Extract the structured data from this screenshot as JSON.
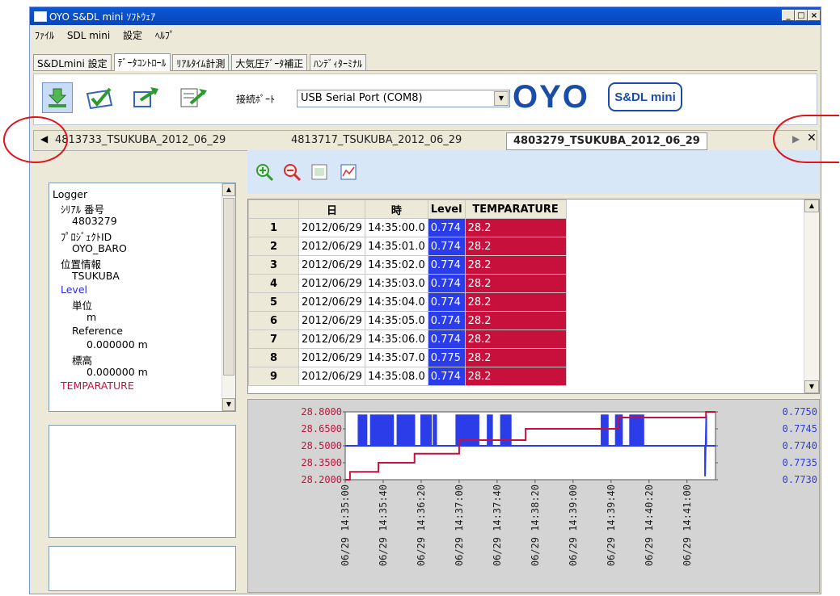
{
  "window": {
    "title": "OYO S&DL mini ｿﾌﾄｳｪｱ"
  },
  "menu": [
    "ﾌｧｲﾙ",
    "SDL mini",
    "設定",
    "ﾍﾙﾌﾟ"
  ],
  "main_tabs": [
    {
      "label": "S&DLmini 設定",
      "active": false
    },
    {
      "label": "ﾃﾞｰﾀｺﾝﾄﾛｰﾙ",
      "active": true
    },
    {
      "label": "ﾘｱﾙﾀｲﾑ計測",
      "active": false
    },
    {
      "label": "大気圧ﾃﾞｰﾀ補正",
      "active": false
    },
    {
      "label": "ﾊﾝﾃﾞｨﾀｰﾐﾅﾙ",
      "active": false
    }
  ],
  "toolbar": {
    "port_label": "接続ﾎﾟｰﾄ",
    "port_value": "USB Serial Port (COM8)",
    "logo_oyo": "OYO",
    "logo_sdl": "S&DL mini"
  },
  "file_tabs": [
    {
      "label": "4813733_TSUKUBA_2012_06_29",
      "active": false
    },
    {
      "label": "4813717_TSUKUBA_2012_06_29",
      "active": false
    },
    {
      "label": "4803279_TSUKUBA_2012_06_29",
      "active": true
    }
  ],
  "tree": {
    "root": "Logger",
    "serial_label": "ｼﾘｱﾙ 番号",
    "serial_value": "4803279",
    "project_label": "ﾌﾟﾛｼﾞｪｸﾄID",
    "project_value": "OYO_BARO",
    "location_label": "位置情報",
    "location_value": "TSUKUBA",
    "level_label": "Level",
    "unit_label": "単位",
    "unit_value": "m",
    "reference_label": "Reference",
    "reference_value": "0.000000 m",
    "elevation_label": "標高",
    "elevation_value": "0.000000 m",
    "temp_label": "TEMPARATURE"
  },
  "table": {
    "headers": [
      "日",
      "時",
      "Level",
      "TEMPARATURE"
    ],
    "rows": [
      [
        "1",
        "2012/06/29",
        "14:35:00.0",
        "0.774",
        "28.2"
      ],
      [
        "2",
        "2012/06/29",
        "14:35:01.0",
        "0.774",
        "28.2"
      ],
      [
        "3",
        "2012/06/29",
        "14:35:02.0",
        "0.774",
        "28.2"
      ],
      [
        "4",
        "2012/06/29",
        "14:35:03.0",
        "0.774",
        "28.2"
      ],
      [
        "5",
        "2012/06/29",
        "14:35:04.0",
        "0.774",
        "28.2"
      ],
      [
        "6",
        "2012/06/29",
        "14:35:05.0",
        "0.774",
        "28.2"
      ],
      [
        "7",
        "2012/06/29",
        "14:35:06.0",
        "0.774",
        "28.2"
      ],
      [
        "8",
        "2012/06/29",
        "14:35:07.0",
        "0.775",
        "28.2"
      ],
      [
        "9",
        "2012/06/29",
        "14:35:08.0",
        "0.774",
        "28.2"
      ]
    ]
  },
  "colors": {
    "level": "#2a3de8",
    "temperature": "#c8103c",
    "annotation": "#e0121a"
  },
  "chart_data": {
    "type": "line",
    "left_axis_ticks": [
      "28.8000",
      "28.6500",
      "28.5000",
      "28.3500",
      "28.2000"
    ],
    "right_axis_ticks": [
      "0.7750",
      "0.7745",
      "0.7740",
      "0.7735",
      "0.7730"
    ],
    "x_ticks": [
      "06/29 14:35:00",
      "06/29 14:35:40",
      "06/29 14:36:20",
      "06/29 14:37:00",
      "06/29 14:37:40",
      "06/29 14:38:20",
      "06/29 14:39:00",
      "06/29 14:39:40",
      "06/29 14:40:20",
      "06/29 14:41:00"
    ],
    "x_seconds": [
      0,
      40,
      80,
      120,
      160,
      200,
      240,
      280,
      320,
      360
    ],
    "series": [
      {
        "name": "TEMPARATURE",
        "axis": "left",
        "steps": [
          [
            0,
            28.2
          ],
          [
            5,
            28.2
          ],
          [
            5,
            28.27
          ],
          [
            35,
            28.27
          ],
          [
            35,
            28.35
          ],
          [
            73,
            28.35
          ],
          [
            73,
            28.43
          ],
          [
            120,
            28.43
          ],
          [
            120,
            28.55
          ],
          [
            190,
            28.55
          ],
          [
            190,
            28.65
          ],
          [
            288,
            28.65
          ],
          [
            288,
            28.75
          ],
          [
            380,
            28.75
          ],
          [
            380,
            28.8
          ],
          [
            390,
            28.8
          ]
        ]
      },
      {
        "name": "Level",
        "axis": "right",
        "baseline": 0.774,
        "spike": 0.7749,
        "bursts": [
          [
            14,
            22
          ],
          [
            27,
            51
          ],
          [
            55,
            72
          ],
          [
            80,
            90
          ],
          [
            93,
            96
          ],
          [
            117,
            140
          ],
          [
            150,
            155
          ],
          [
            164,
            175
          ],
          [
            270,
            276
          ],
          [
            285,
            292
          ],
          [
            300,
            314
          ]
        ],
        "drop_at": 379,
        "drop_value": 0.7731
      }
    ],
    "x_range": [
      0,
      390
    ],
    "left_range": [
      28.2,
      28.8
    ],
    "right_range": [
      0.773,
      0.775
    ]
  }
}
